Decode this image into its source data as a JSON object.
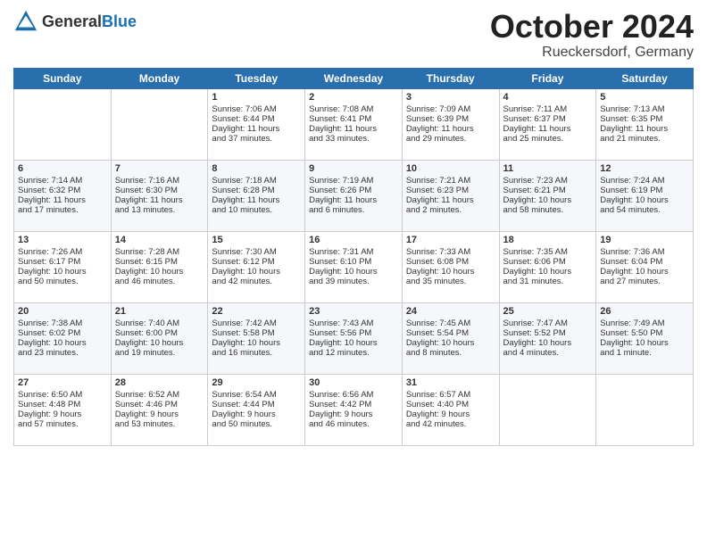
{
  "header": {
    "logo_general": "General",
    "logo_blue": "Blue",
    "month_title": "October 2024",
    "location": "Rueckersdorf, Germany"
  },
  "days_of_week": [
    "Sunday",
    "Monday",
    "Tuesday",
    "Wednesday",
    "Thursday",
    "Friday",
    "Saturday"
  ],
  "weeks": [
    [
      {
        "day": "",
        "content": ""
      },
      {
        "day": "",
        "content": ""
      },
      {
        "day": "1",
        "content": "Sunrise: 7:06 AM\nSunset: 6:44 PM\nDaylight: 11 hours\nand 37 minutes."
      },
      {
        "day": "2",
        "content": "Sunrise: 7:08 AM\nSunset: 6:41 PM\nDaylight: 11 hours\nand 33 minutes."
      },
      {
        "day": "3",
        "content": "Sunrise: 7:09 AM\nSunset: 6:39 PM\nDaylight: 11 hours\nand 29 minutes."
      },
      {
        "day": "4",
        "content": "Sunrise: 7:11 AM\nSunset: 6:37 PM\nDaylight: 11 hours\nand 25 minutes."
      },
      {
        "day": "5",
        "content": "Sunrise: 7:13 AM\nSunset: 6:35 PM\nDaylight: 11 hours\nand 21 minutes."
      }
    ],
    [
      {
        "day": "6",
        "content": "Sunrise: 7:14 AM\nSunset: 6:32 PM\nDaylight: 11 hours\nand 17 minutes."
      },
      {
        "day": "7",
        "content": "Sunrise: 7:16 AM\nSunset: 6:30 PM\nDaylight: 11 hours\nand 13 minutes."
      },
      {
        "day": "8",
        "content": "Sunrise: 7:18 AM\nSunset: 6:28 PM\nDaylight: 11 hours\nand 10 minutes."
      },
      {
        "day": "9",
        "content": "Sunrise: 7:19 AM\nSunset: 6:26 PM\nDaylight: 11 hours\nand 6 minutes."
      },
      {
        "day": "10",
        "content": "Sunrise: 7:21 AM\nSunset: 6:23 PM\nDaylight: 11 hours\nand 2 minutes."
      },
      {
        "day": "11",
        "content": "Sunrise: 7:23 AM\nSunset: 6:21 PM\nDaylight: 10 hours\nand 58 minutes."
      },
      {
        "day": "12",
        "content": "Sunrise: 7:24 AM\nSunset: 6:19 PM\nDaylight: 10 hours\nand 54 minutes."
      }
    ],
    [
      {
        "day": "13",
        "content": "Sunrise: 7:26 AM\nSunset: 6:17 PM\nDaylight: 10 hours\nand 50 minutes."
      },
      {
        "day": "14",
        "content": "Sunrise: 7:28 AM\nSunset: 6:15 PM\nDaylight: 10 hours\nand 46 minutes."
      },
      {
        "day": "15",
        "content": "Sunrise: 7:30 AM\nSunset: 6:12 PM\nDaylight: 10 hours\nand 42 minutes."
      },
      {
        "day": "16",
        "content": "Sunrise: 7:31 AM\nSunset: 6:10 PM\nDaylight: 10 hours\nand 39 minutes."
      },
      {
        "day": "17",
        "content": "Sunrise: 7:33 AM\nSunset: 6:08 PM\nDaylight: 10 hours\nand 35 minutes."
      },
      {
        "day": "18",
        "content": "Sunrise: 7:35 AM\nSunset: 6:06 PM\nDaylight: 10 hours\nand 31 minutes."
      },
      {
        "day": "19",
        "content": "Sunrise: 7:36 AM\nSunset: 6:04 PM\nDaylight: 10 hours\nand 27 minutes."
      }
    ],
    [
      {
        "day": "20",
        "content": "Sunrise: 7:38 AM\nSunset: 6:02 PM\nDaylight: 10 hours\nand 23 minutes."
      },
      {
        "day": "21",
        "content": "Sunrise: 7:40 AM\nSunset: 6:00 PM\nDaylight: 10 hours\nand 19 minutes."
      },
      {
        "day": "22",
        "content": "Sunrise: 7:42 AM\nSunset: 5:58 PM\nDaylight: 10 hours\nand 16 minutes."
      },
      {
        "day": "23",
        "content": "Sunrise: 7:43 AM\nSunset: 5:56 PM\nDaylight: 10 hours\nand 12 minutes."
      },
      {
        "day": "24",
        "content": "Sunrise: 7:45 AM\nSunset: 5:54 PM\nDaylight: 10 hours\nand 8 minutes."
      },
      {
        "day": "25",
        "content": "Sunrise: 7:47 AM\nSunset: 5:52 PM\nDaylight: 10 hours\nand 4 minutes."
      },
      {
        "day": "26",
        "content": "Sunrise: 7:49 AM\nSunset: 5:50 PM\nDaylight: 10 hours\nand 1 minute."
      }
    ],
    [
      {
        "day": "27",
        "content": "Sunrise: 6:50 AM\nSunset: 4:48 PM\nDaylight: 9 hours\nand 57 minutes."
      },
      {
        "day": "28",
        "content": "Sunrise: 6:52 AM\nSunset: 4:46 PM\nDaylight: 9 hours\nand 53 minutes."
      },
      {
        "day": "29",
        "content": "Sunrise: 6:54 AM\nSunset: 4:44 PM\nDaylight: 9 hours\nand 50 minutes."
      },
      {
        "day": "30",
        "content": "Sunrise: 6:56 AM\nSunset: 4:42 PM\nDaylight: 9 hours\nand 46 minutes."
      },
      {
        "day": "31",
        "content": "Sunrise: 6:57 AM\nSunset: 4:40 PM\nDaylight: 9 hours\nand 42 minutes."
      },
      {
        "day": "",
        "content": ""
      },
      {
        "day": "",
        "content": ""
      }
    ]
  ]
}
